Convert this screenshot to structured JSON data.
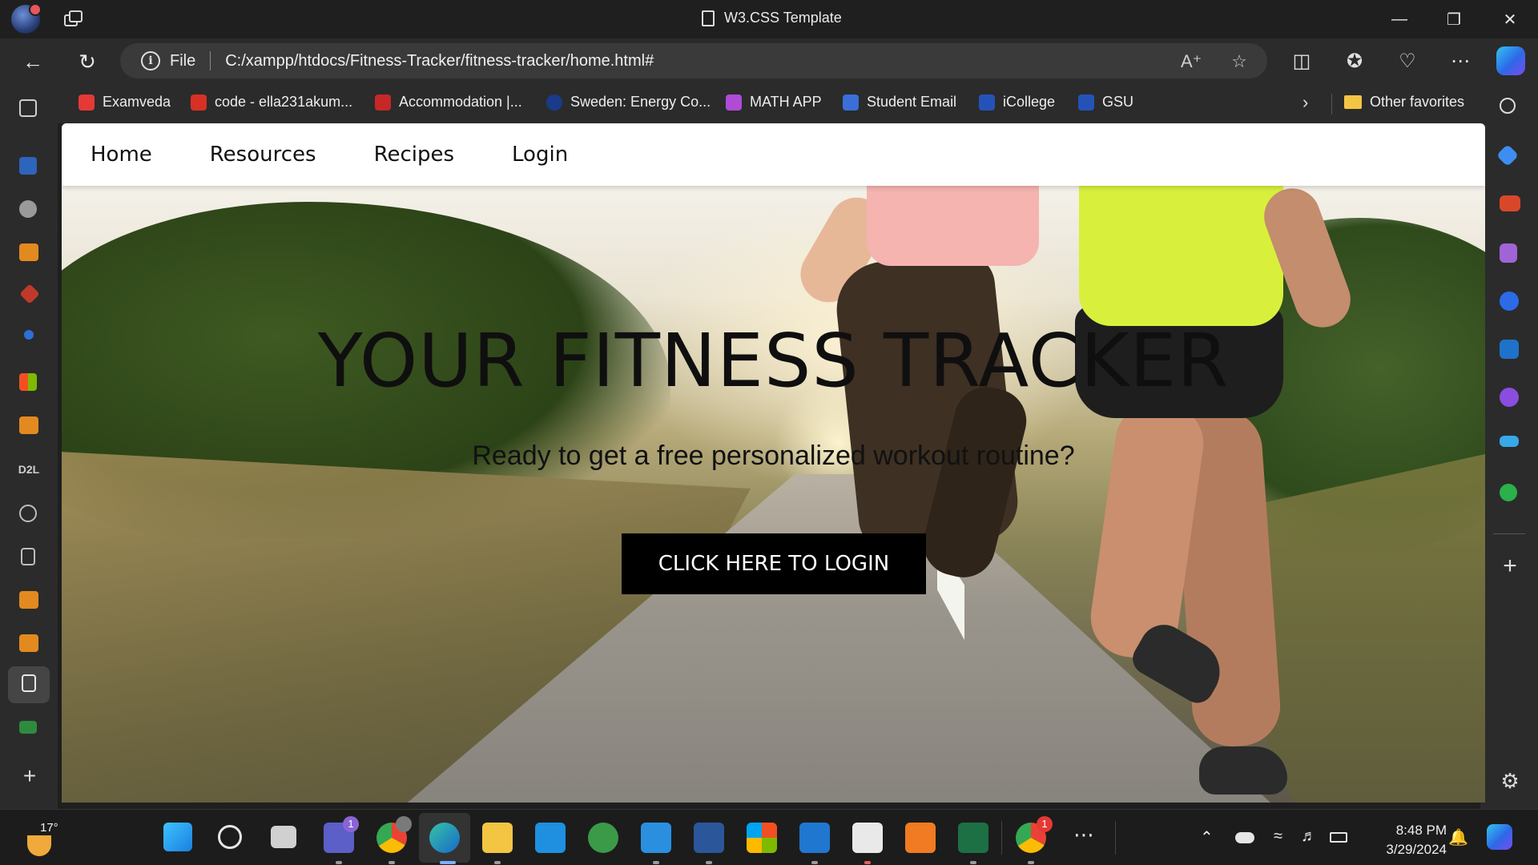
{
  "window": {
    "title": "W3.CSS Template"
  },
  "address_bar": {
    "scheme_label": "File",
    "url": "C:/xampp/htdocs/Fitness-Tracker/fitness-tracker/home.html#"
  },
  "favorites": [
    {
      "label": "Examveda",
      "color": "#e53935"
    },
    {
      "label": "code - ella231akum...",
      "color": "#d93025"
    },
    {
      "label": "Accommodation |...",
      "color": "#c62828"
    },
    {
      "label": "Sweden: Energy Co...",
      "color": "#1a3b8a"
    },
    {
      "label": "MATH APP",
      "color": "#b04bd6"
    },
    {
      "label": "Student Email",
      "color": "#3b6fd8"
    },
    {
      "label": "iCollege",
      "color": "#2453b8"
    },
    {
      "label": "GSU",
      "color": "#2453b8"
    }
  ],
  "favorites_other": "Other favorites",
  "left_sidebar_text": {
    "d2l": "D2L"
  },
  "site": {
    "nav": [
      "Home",
      "Resources",
      "Recipes",
      "Login"
    ],
    "hero_title": "YOUR FITNESS TRACKER",
    "hero_subtitle": "Ready to get a free personalized workout routine?",
    "hero_button": "CLICK HERE TO LOGIN"
  },
  "taskbar": {
    "temperature": "17°",
    "teams_badge": "1",
    "chrome_badge": "1",
    "time": "8:48 PM",
    "date": "3/29/2024"
  },
  "colors": {
    "accent": "#000000",
    "browser_chrome": "#2b2b2b",
    "titlebar": "#1f1f1f"
  }
}
